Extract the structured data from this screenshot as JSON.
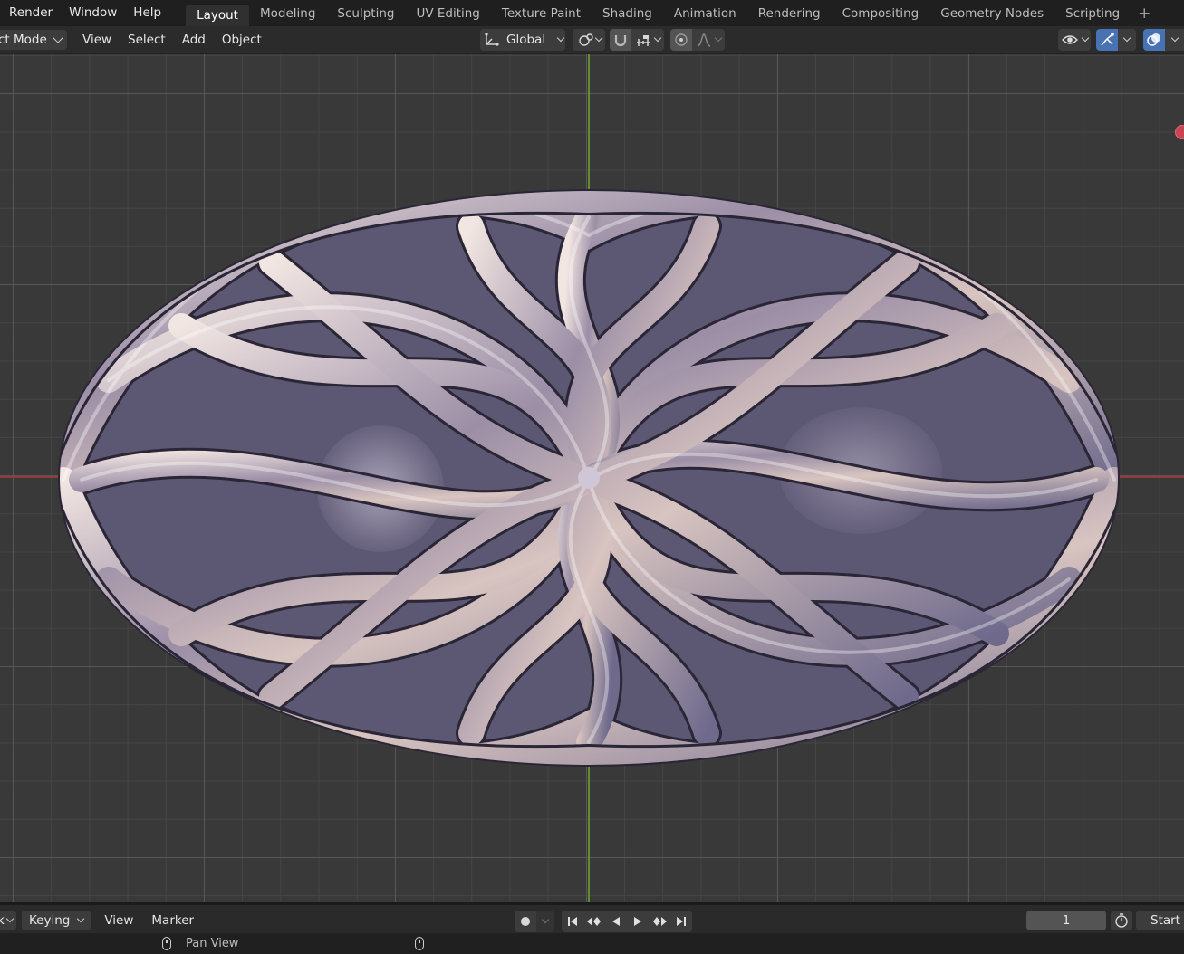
{
  "topbar": {
    "menus": [
      "Render",
      "Window",
      "Help"
    ],
    "tabs": [
      {
        "label": "Layout",
        "active": true
      },
      {
        "label": "Modeling",
        "active": false
      },
      {
        "label": "Sculpting",
        "active": false
      },
      {
        "label": "UV Editing",
        "active": false
      },
      {
        "label": "Texture Paint",
        "active": false
      },
      {
        "label": "Shading",
        "active": false
      },
      {
        "label": "Animation",
        "active": false
      },
      {
        "label": "Rendering",
        "active": false
      },
      {
        "label": "Compositing",
        "active": false
      },
      {
        "label": "Geometry Nodes",
        "active": false
      },
      {
        "label": "Scripting",
        "active": false
      }
    ],
    "add_tab_icon": "plus-icon"
  },
  "viewport_header": {
    "mode": "ct Mode",
    "menus": [
      "View",
      "Select",
      "Add",
      "Object"
    ],
    "transform_orientation": "Global"
  },
  "timeline": {
    "left_partial": "k",
    "keying": "Keying",
    "menus": [
      "View",
      "Marker"
    ],
    "current_frame": "1",
    "start_label": "Start"
  },
  "statusbar": {
    "hint": "Pan View"
  },
  "colors": {
    "background": "#393939",
    "x_axis": "#a23a3a",
    "y_axis": "#6c9a2e",
    "accent": "#4772b3"
  }
}
